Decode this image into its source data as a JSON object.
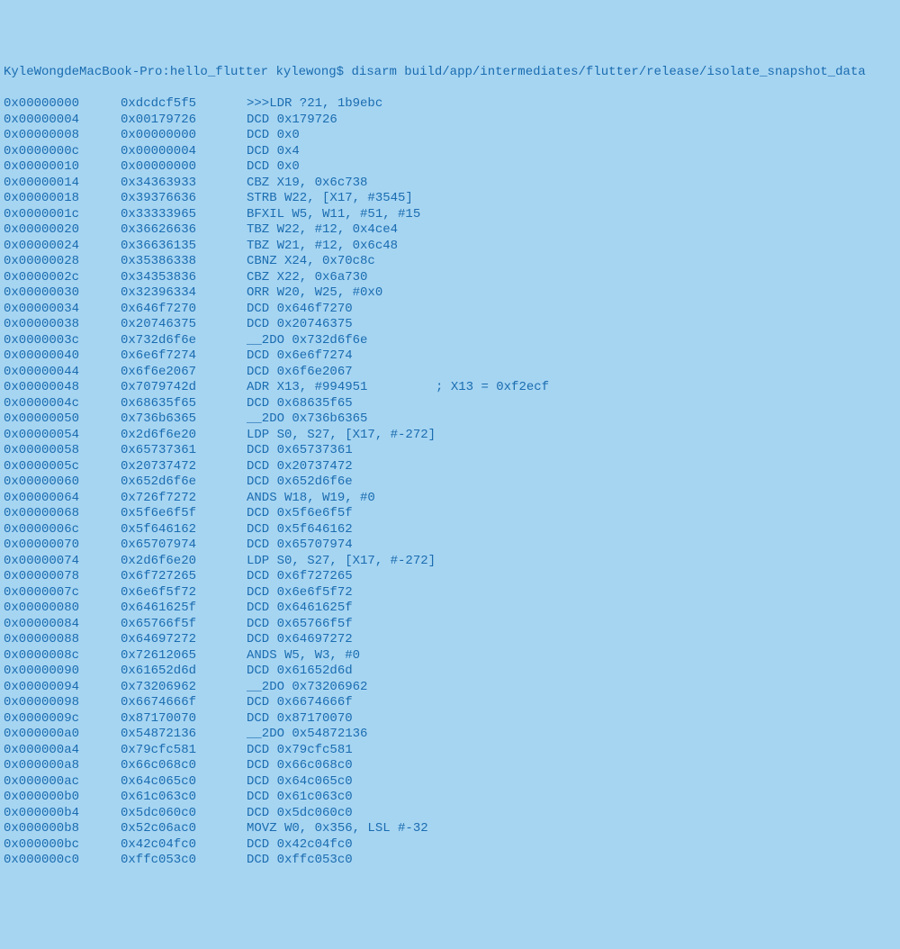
{
  "prompt": "KyleWongdeMacBook-Pro:hello_flutter kylewong$ disarm build/app/intermediates/flutter/release/isolate_snapshot_data",
  "rows": [
    {
      "addr": "0x00000000",
      "hex": "0xdcdcf5f5",
      "inst": ">>>LDR ?21, 1b9ebc"
    },
    {
      "addr": "0x00000004",
      "hex": "0x00179726",
      "inst": "DCD 0x179726"
    },
    {
      "addr": "0x00000008",
      "hex": "0x00000000",
      "inst": "DCD 0x0"
    },
    {
      "addr": "0x0000000c",
      "hex": "0x00000004",
      "inst": "DCD 0x4"
    },
    {
      "addr": "0x00000010",
      "hex": "0x00000000",
      "inst": "DCD 0x0"
    },
    {
      "addr": "0x00000014",
      "hex": "0x34363933",
      "inst": "CBZ X19, 0x6c738"
    },
    {
      "addr": "0x00000018",
      "hex": "0x39376636",
      "inst": "STRB W22, [X17, #3545]"
    },
    {
      "addr": "0x0000001c",
      "hex": "0x33333965",
      "inst": "BFXIL W5, W11, #51, #15"
    },
    {
      "addr": "0x00000020",
      "hex": "0x36626636",
      "inst": "TBZ W22, #12, 0x4ce4"
    },
    {
      "addr": "0x00000024",
      "hex": "0x36636135",
      "inst": "TBZ W21, #12, 0x6c48"
    },
    {
      "addr": "0x00000028",
      "hex": "0x35386338",
      "inst": "CBNZ X24, 0x70c8c"
    },
    {
      "addr": "0x0000002c",
      "hex": "0x34353836",
      "inst": "CBZ X22, 0x6a730"
    },
    {
      "addr": "0x00000030",
      "hex": "0x32396334",
      "inst": "ORR W20, W25, #0x0"
    },
    {
      "addr": "0x00000034",
      "hex": "0x646f7270",
      "inst": "DCD 0x646f7270"
    },
    {
      "addr": "0x00000038",
      "hex": "0x20746375",
      "inst": "DCD 0x20746375"
    },
    {
      "addr": "0x0000003c",
      "hex": "0x732d6f6e",
      "inst": "__2DO 0x732d6f6e"
    },
    {
      "addr": "0x00000040",
      "hex": "0x6e6f7274",
      "inst": "DCD 0x6e6f7274"
    },
    {
      "addr": "0x00000044",
      "hex": "0x6f6e2067",
      "inst": "DCD 0x6f6e2067"
    },
    {
      "addr": "0x00000048",
      "hex": "0x7079742d",
      "inst": "ADR X13, #994951         ; X13 = 0xf2ecf"
    },
    {
      "addr": "0x0000004c",
      "hex": "0x68635f65",
      "inst": "DCD 0x68635f65"
    },
    {
      "addr": "0x00000050",
      "hex": "0x736b6365",
      "inst": "__2DO 0x736b6365"
    },
    {
      "addr": "0x00000054",
      "hex": "0x2d6f6e20",
      "inst": "LDP S0, S27, [X17, #-272]"
    },
    {
      "addr": "0x00000058",
      "hex": "0x65737361",
      "inst": "DCD 0x65737361"
    },
    {
      "addr": "0x0000005c",
      "hex": "0x20737472",
      "inst": "DCD 0x20737472"
    },
    {
      "addr": "0x00000060",
      "hex": "0x652d6f6e",
      "inst": "DCD 0x652d6f6e"
    },
    {
      "addr": "0x00000064",
      "hex": "0x726f7272",
      "inst": "ANDS W18, W19, #0"
    },
    {
      "addr": "0x00000068",
      "hex": "0x5f6e6f5f",
      "inst": "DCD 0x5f6e6f5f"
    },
    {
      "addr": "0x0000006c",
      "hex": "0x5f646162",
      "inst": "DCD 0x5f646162"
    },
    {
      "addr": "0x00000070",
      "hex": "0x65707974",
      "inst": "DCD 0x65707974"
    },
    {
      "addr": "0x00000074",
      "hex": "0x2d6f6e20",
      "inst": "LDP S0, S27, [X17, #-272]"
    },
    {
      "addr": "0x00000078",
      "hex": "0x6f727265",
      "inst": "DCD 0x6f727265"
    },
    {
      "addr": "0x0000007c",
      "hex": "0x6e6f5f72",
      "inst": "DCD 0x6e6f5f72"
    },
    {
      "addr": "0x00000080",
      "hex": "0x6461625f",
      "inst": "DCD 0x6461625f"
    },
    {
      "addr": "0x00000084",
      "hex": "0x65766f5f",
      "inst": "DCD 0x65766f5f"
    },
    {
      "addr": "0x00000088",
      "hex": "0x64697272",
      "inst": "DCD 0x64697272"
    },
    {
      "addr": "0x0000008c",
      "hex": "0x72612065",
      "inst": "ANDS W5, W3, #0"
    },
    {
      "addr": "0x00000090",
      "hex": "0x61652d6d",
      "inst": "DCD 0x61652d6d"
    },
    {
      "addr": "0x00000094",
      "hex": "0x73206962",
      "inst": "__2DO 0x73206962"
    },
    {
      "addr": "0x00000098",
      "hex": "0x6674666f",
      "inst": "DCD 0x6674666f"
    },
    {
      "addr": "0x0000009c",
      "hex": "0x87170070",
      "inst": "DCD 0x87170070"
    },
    {
      "addr": "0x000000a0",
      "hex": "0x54872136",
      "inst": "__2DO 0x54872136"
    },
    {
      "addr": "0x000000a4",
      "hex": "0x79cfc581",
      "inst": "DCD 0x79cfc581"
    },
    {
      "addr": "0x000000a8",
      "hex": "0x66c068c0",
      "inst": "DCD 0x66c068c0"
    },
    {
      "addr": "0x000000ac",
      "hex": "0x64c065c0",
      "inst": "DCD 0x64c065c0"
    },
    {
      "addr": "0x000000b0",
      "hex": "0x61c063c0",
      "inst": "DCD 0x61c063c0"
    },
    {
      "addr": "0x000000b4",
      "hex": "0x5dc060c0",
      "inst": "DCD 0x5dc060c0"
    },
    {
      "addr": "0x000000b8",
      "hex": "0x52c06ac0",
      "inst": "MOVZ W0, 0x356, LSL #-32"
    },
    {
      "addr": "0x000000bc",
      "hex": "0x42c04fc0",
      "inst": "DCD 0x42c04fc0"
    },
    {
      "addr": "0x000000c0",
      "hex": "0xffc053c0",
      "inst": "DCD 0xffc053c0"
    }
  ]
}
